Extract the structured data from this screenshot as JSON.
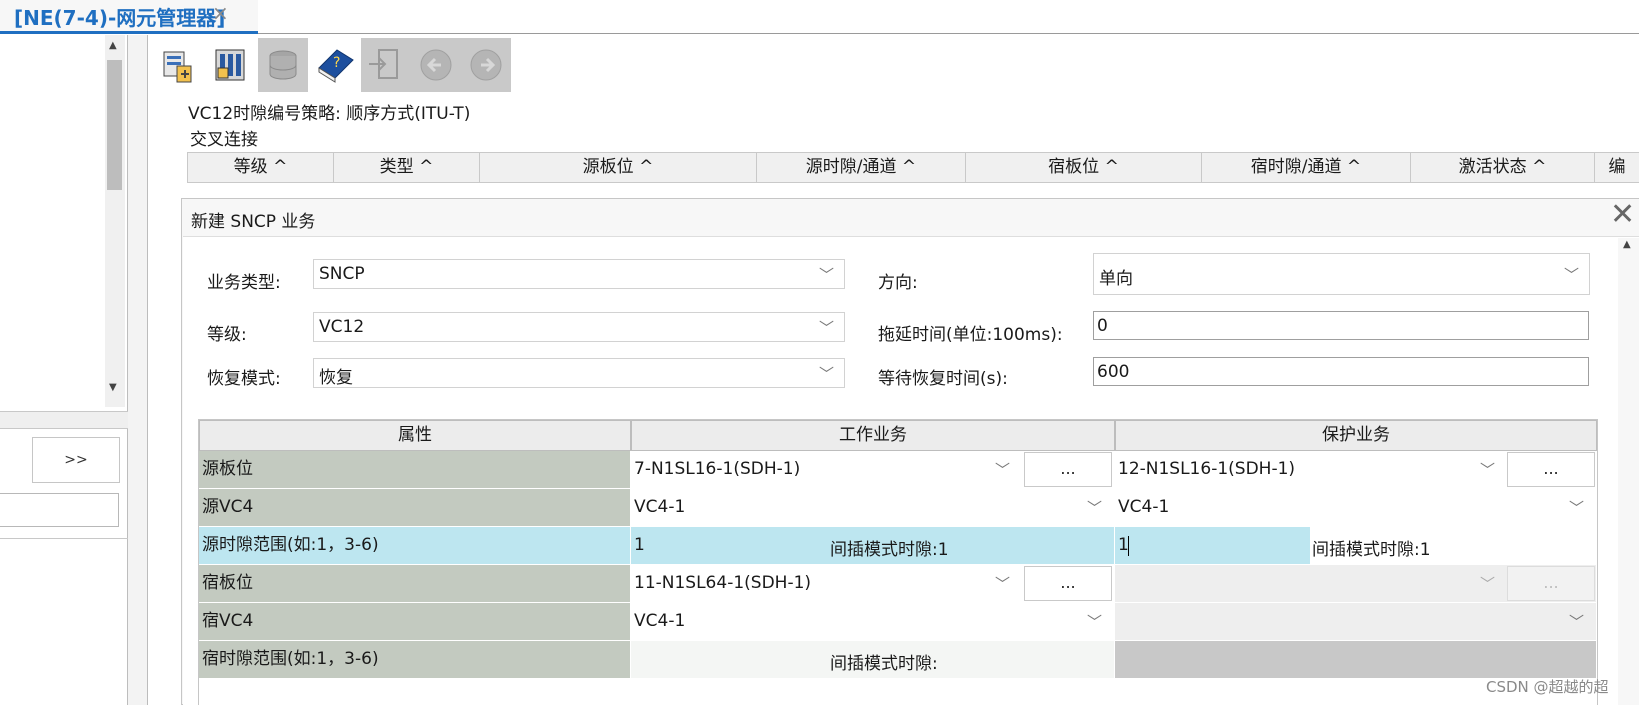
{
  "tab": {
    "title": "[NE(7-4)-网元管理器]",
    "close": "×"
  },
  "left": {
    "expand_label": ">>",
    "scroll_up": "▲",
    "scroll_down": "▼"
  },
  "toolbar": {
    "icons": [
      "ne-config-icon",
      "board-icon",
      "database-icon",
      "help-book-icon",
      "exit-icon",
      "back-icon",
      "forward-icon"
    ]
  },
  "header": {
    "strategy": "VC12时隙编号策略: 顺序方式(ITU-T)",
    "cross_connect": "交叉连接",
    "columns": [
      "等级 ^",
      "类型 ^",
      "源板位 ^",
      "源时隙/通道 ^",
      "宿板位 ^",
      "宿时隙/通道 ^",
      "激活状态 ^",
      "编"
    ]
  },
  "dialog": {
    "title": "新建 SNCP 业务",
    "close": "✕",
    "fields": {
      "service_type_label": "业务类型:",
      "service_type_value": "SNCP",
      "direction_label": "方向:",
      "direction_value": "单向",
      "level_label": "等级:",
      "level_value": "VC12",
      "hold_off_label": "拖延时间(单位:100ms):",
      "hold_off_value": "0",
      "revert_label": "恢复模式:",
      "revert_value": "恢复",
      "wtr_label": "等待恢复时间(s):",
      "wtr_value": "600"
    },
    "grid": {
      "headers": [
        "属性",
        "工作业务",
        "保护业务"
      ],
      "rows": {
        "src_board": {
          "label": "源板位",
          "work": "7-N1SL16-1(SDH-1)",
          "prot": "12-N1SL16-1(SDH-1)",
          "btn": "..."
        },
        "src_vc4": {
          "label": "源VC4",
          "work": "VC4-1",
          "prot": "VC4-1"
        },
        "src_ts": {
          "label": "源时隙范围(如:1，3-6)",
          "work": "1",
          "work_inter": "间插模式时隙:1",
          "prot": "1",
          "prot_inter": "间插模式时隙:1"
        },
        "sink_board": {
          "label": "宿板位",
          "work": "11-N1SL64-1(SDH-1)",
          "btn": "..."
        },
        "sink_vc4": {
          "label": "宿VC4",
          "work": "VC4-1"
        },
        "sink_ts": {
          "label": "宿时隙范围(如:1，3-6)",
          "work_inter": "间插模式时隙:"
        }
      }
    }
  },
  "watermark": "CSDN @超越的超",
  "colors": {
    "accent": "#1f6fc1",
    "prop_bg": "#c3cac0",
    "selected_bg": "#bde6f0"
  }
}
